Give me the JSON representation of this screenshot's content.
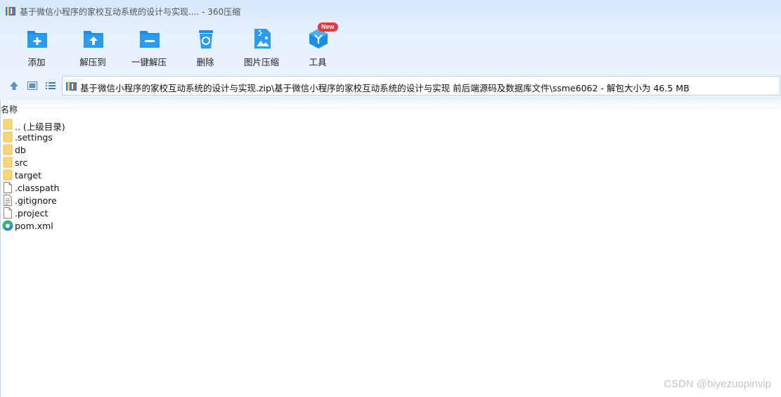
{
  "window": {
    "title": "基于微信小程序的家校互动系统的设计与实现.... - 360压缩"
  },
  "toolbar": {
    "add": "添加",
    "extract_to": "解压到",
    "one_click_extract": "一键解压",
    "delete": "删除",
    "image_compress": "图片压缩",
    "tools": "工具",
    "tools_badge": "New"
  },
  "address": {
    "path": "基于微信小程序的家校互动系统的设计与实现.zip\\基于微信小程序的家校互动系统的设计与实现 前后端源码及数据库文件\\ssme6062 - 解包大小为 46.5 MB"
  },
  "list": {
    "column_name": "名称",
    "items": [
      {
        "name": ".. (上级目录)",
        "icon": "folder-icon"
      },
      {
        "name": ".settings",
        "icon": "folder-icon"
      },
      {
        "name": "db",
        "icon": "folder-icon"
      },
      {
        "name": "src",
        "icon": "folder-icon"
      },
      {
        "name": "target",
        "icon": "folder-icon"
      },
      {
        "name": ".classpath",
        "icon": "file-icon"
      },
      {
        "name": ".gitignore",
        "icon": "text-file-icon"
      },
      {
        "name": ".project",
        "icon": "file-icon"
      },
      {
        "name": "pom.xml",
        "icon": "edge-browser-icon"
      }
    ]
  },
  "watermark": "CSDN @biyezuopinvip",
  "colors": {
    "accent": "#1a8fe8",
    "folder": "#f9d776",
    "badge": "#e8363b"
  }
}
